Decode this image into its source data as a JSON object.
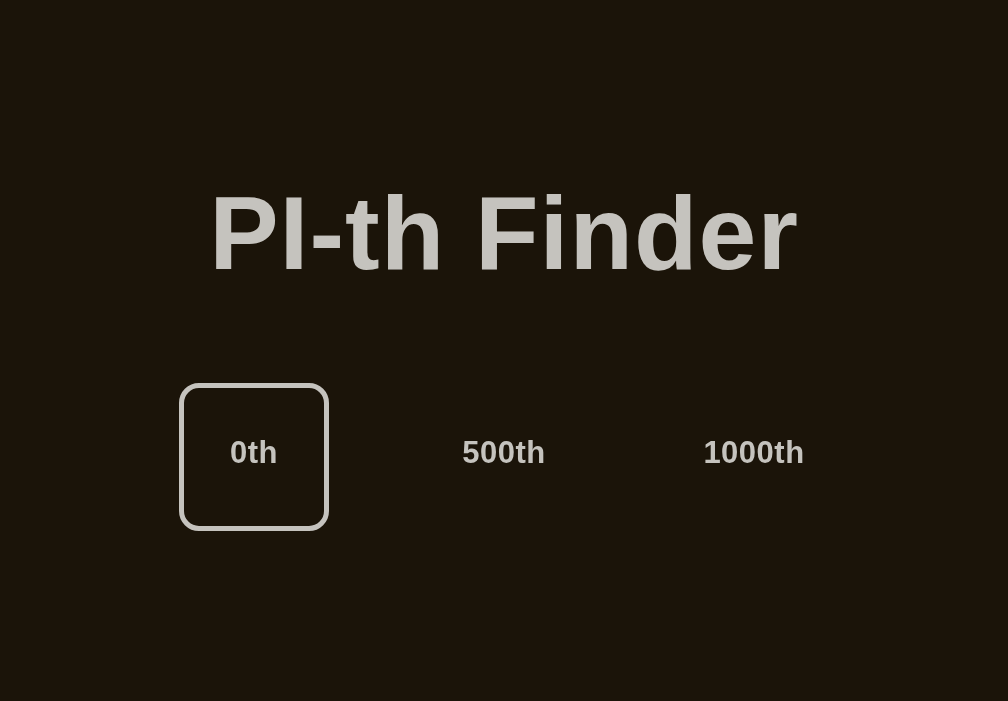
{
  "title": "PI-th Finder",
  "options": [
    {
      "label": "0th",
      "selected": true
    },
    {
      "label": "500th",
      "selected": false
    },
    {
      "label": "1000th",
      "selected": false
    }
  ]
}
